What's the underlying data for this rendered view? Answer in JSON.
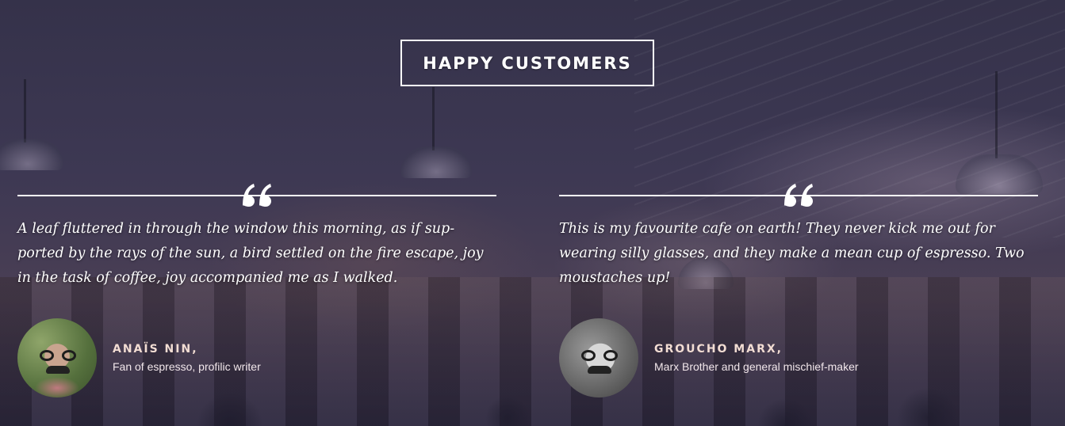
{
  "section": {
    "title": "HAPPY CUSTOMERS"
  },
  "testimonials": [
    {
      "quote": "A leaf fluttered in through the window this morning, as if sup-ported by the rays of the sun, a bird settled on the fire escape, joy in the task of coffee, joy accompanied me as I walked.",
      "name": "ANAÏS NIN,",
      "role": "Fan of espresso, profilic writer"
    },
    {
      "quote": "This is my favourite cafe on earth! They never kick me out for wearing silly glasses, and they make a mean cup of espresso. Two moustaches up!",
      "name": "GROUCHO MARX,",
      "role": "Marx Brother and general mischief-maker"
    }
  ],
  "icons": {
    "quote": "“",
    "quote_icon_name": "quote-icon"
  },
  "colors": {
    "overlay": "#3d3752",
    "name_text": "#f2ddd3",
    "rule": "#ffffff"
  }
}
